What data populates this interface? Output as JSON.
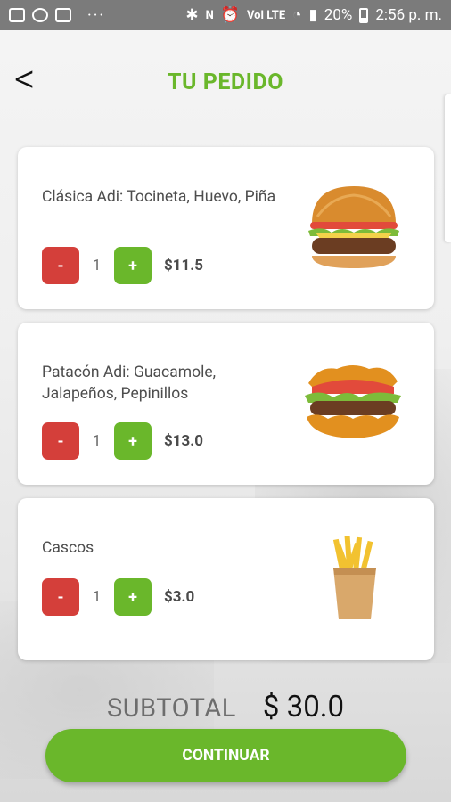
{
  "status_bar": {
    "battery": "20%",
    "time": "2:56 p. m.",
    "network_tag": "Vol LTE",
    "icons": [
      "gallery-icon",
      "messenger-icon",
      "chat-icon",
      "more-dots-icon",
      "bluetooth-icon",
      "nfc-icon",
      "alarm-icon",
      "wifi-icon",
      "signal-icon",
      "battery-icon"
    ]
  },
  "header": {
    "back_label": "<",
    "title": "TU PEDIDO"
  },
  "colors": {
    "accent": "#6ab72b",
    "minus": "#d43f3a",
    "plus": "#6ab72b"
  },
  "items": [
    {
      "name": "Clásica  Adi: Tocineta, Huevo, Piña",
      "qty": "1",
      "price": "$11.5",
      "minus": "-",
      "plus": "+",
      "image": "burger-icon"
    },
    {
      "name": "Patacón  Adi: Guacamole, Jalapeños, Pepinillos",
      "qty": "1",
      "price": "$13.0",
      "minus": "-",
      "plus": "+",
      "image": "patacon-burger-icon"
    },
    {
      "name": "Cascos",
      "qty": "1",
      "price": "$3.0",
      "minus": "-",
      "plus": "+",
      "image": "fries-icon"
    }
  ],
  "summary": {
    "subtotal_label": "SUBTOTAL",
    "subtotal_value": "$ 30.0"
  },
  "actions": {
    "continue_label": "CONTINUAR"
  }
}
